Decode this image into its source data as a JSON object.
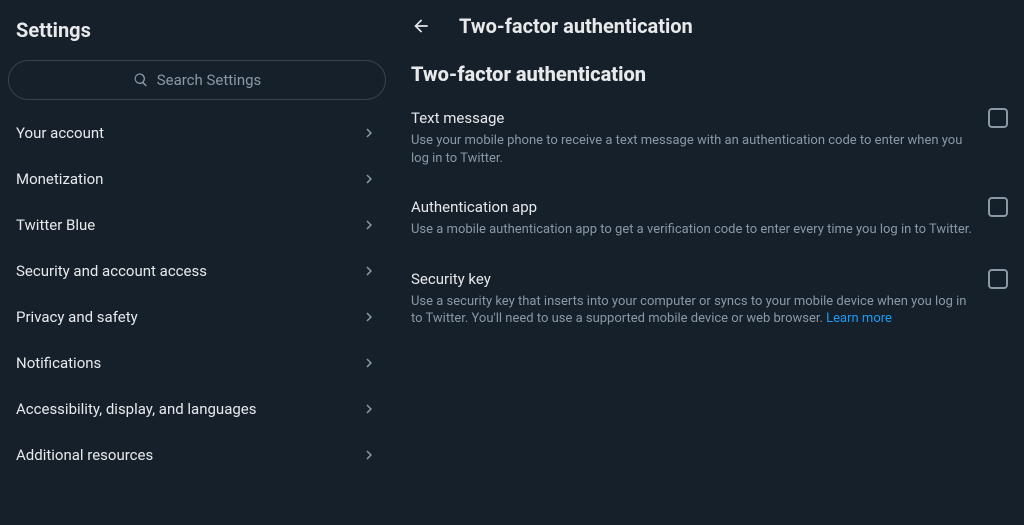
{
  "sidebar": {
    "title": "Settings",
    "search_placeholder": "Search Settings",
    "items": [
      {
        "label": "Your account"
      },
      {
        "label": "Monetization"
      },
      {
        "label": "Twitter Blue"
      },
      {
        "label": "Security and account access"
      },
      {
        "label": "Privacy and safety"
      },
      {
        "label": "Notifications"
      },
      {
        "label": "Accessibility, display, and languages"
      },
      {
        "label": "Additional resources"
      }
    ]
  },
  "main": {
    "topbar_title": "Two-factor authentication",
    "page_heading": "Two-factor authentication",
    "options": [
      {
        "title": "Text message",
        "description": "Use your mobile phone to receive a text message with an authentication code to enter when you log in to Twitter.",
        "checked": false
      },
      {
        "title": "Authentication app",
        "description": "Use a mobile authentication app to get a verification code to enter every time you log in to Twitter.",
        "checked": false
      },
      {
        "title": "Security key",
        "description": "Use a security key that inserts into your computer or syncs to your mobile device when you log in to Twitter. You'll need to use a supported mobile device or web browser. ",
        "learn_more": "Learn more",
        "checked": false
      }
    ]
  }
}
